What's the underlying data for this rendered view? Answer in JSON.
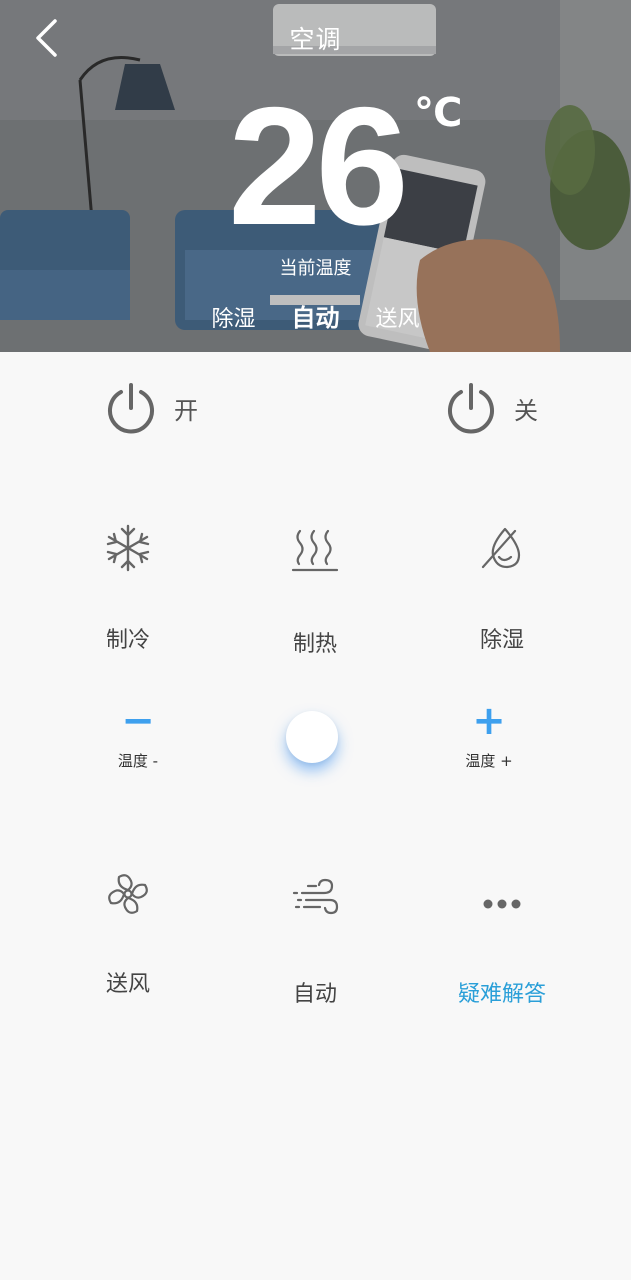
{
  "header": {
    "title": "空调",
    "back_icon": "chevron-left-icon"
  },
  "status": {
    "temperature": "26",
    "unit": "℃",
    "label": "当前温度"
  },
  "modes": {
    "items": [
      "除湿",
      "自动",
      "送风"
    ],
    "active": "自动"
  },
  "power": {
    "on_label": "开",
    "off_label": "关"
  },
  "controls": {
    "cool": "制冷",
    "heat": "制热",
    "dehumidify": "除湿",
    "temp_down_label": "温度 -",
    "temp_up_label": "温度 +",
    "temp_down_symbol": "−",
    "temp_up_symbol": "+",
    "fan": "送风",
    "auto": "自动",
    "faq": "疑难解答"
  },
  "colors": {
    "accent_blue": "#3ea0ee",
    "faq_blue": "#2a9fd8",
    "icon_gray": "#666666"
  }
}
